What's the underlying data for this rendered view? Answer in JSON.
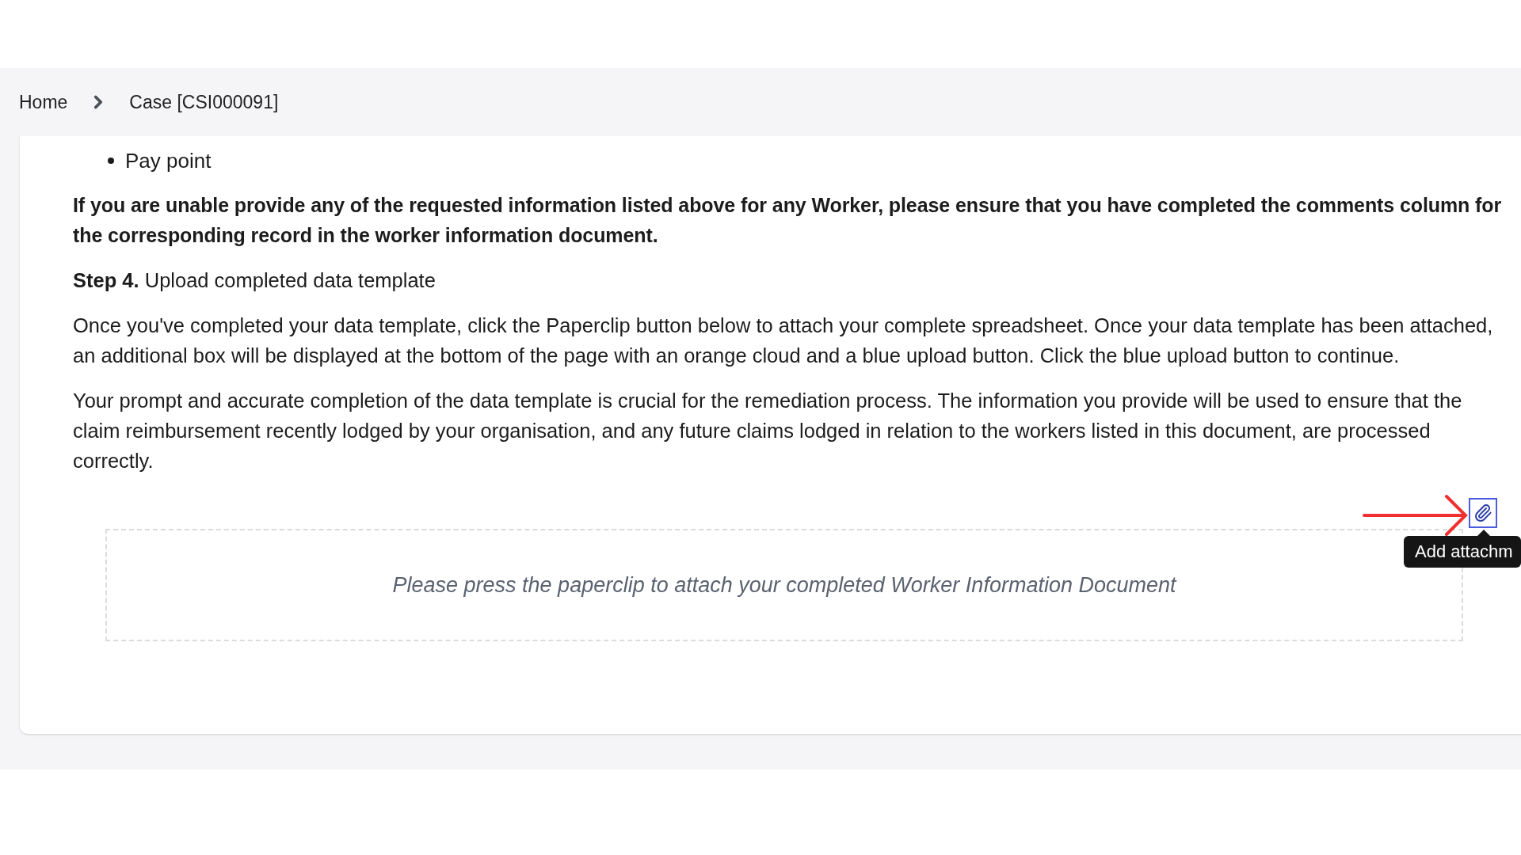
{
  "breadcrumb": [
    {
      "label": "Home"
    },
    {
      "label": "Case [CSI000091]"
    }
  ],
  "bullets": [
    "Pay point"
  ],
  "notice": "If you are unable provide any of the requested information listed above for any Worker, please ensure that you have completed the comments column for the corresponding record in the worker information document.",
  "step": "**Step 4.** Upload completed data template",
  "paragraphs": [
    "Once you've completed your data template, click the Paperclip button below to attach your complete spreadsheet. Once your data template has been attached, an additional box will be displayed at the bottom of the page with an orange cloud and a blue upload button. Click the blue upload button to continue.",
    "Your prompt and accurate completion of the data template is crucial for the remediation process. The information you provide will be used to ensure that the claim reimbursement recently lodged by your organisation, and any future claims lodged in relation to the workers listed in this document, are processed correctly."
  ],
  "attach_button": {
    "tooltip": "Add attachm"
  },
  "drop_zone": {
    "message": "Please press the paperclip to attach your completed Worker Information Document"
  }
}
